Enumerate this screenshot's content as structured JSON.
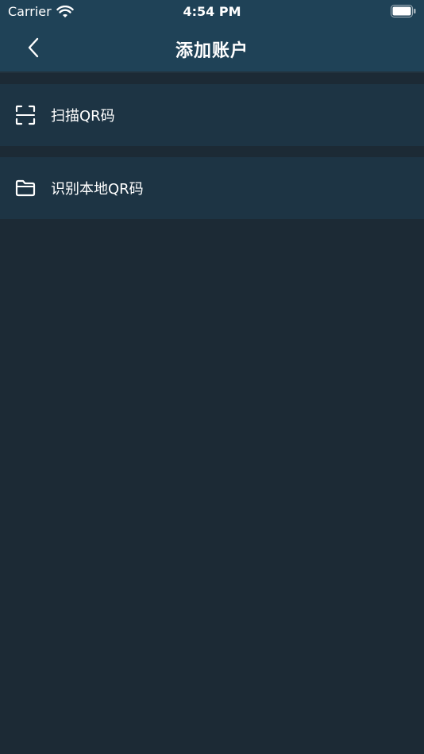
{
  "status_bar": {
    "carrier": "Carrier",
    "time": "4:54 PM",
    "wifi_icon": "wifi-icon",
    "battery_icon": "battery-icon"
  },
  "nav": {
    "title": "添加账户",
    "back_icon": "chevron-left-icon"
  },
  "menu": {
    "items": [
      {
        "label": "扫描QR码",
        "icon": "scan-icon"
      },
      {
        "label": "识别本地QR码",
        "icon": "folder-icon"
      }
    ]
  },
  "colors": {
    "nav_background": "#1f4257",
    "page_background": "#1c2a35",
    "item_background": "#1d3444",
    "text": "#ffffff"
  }
}
